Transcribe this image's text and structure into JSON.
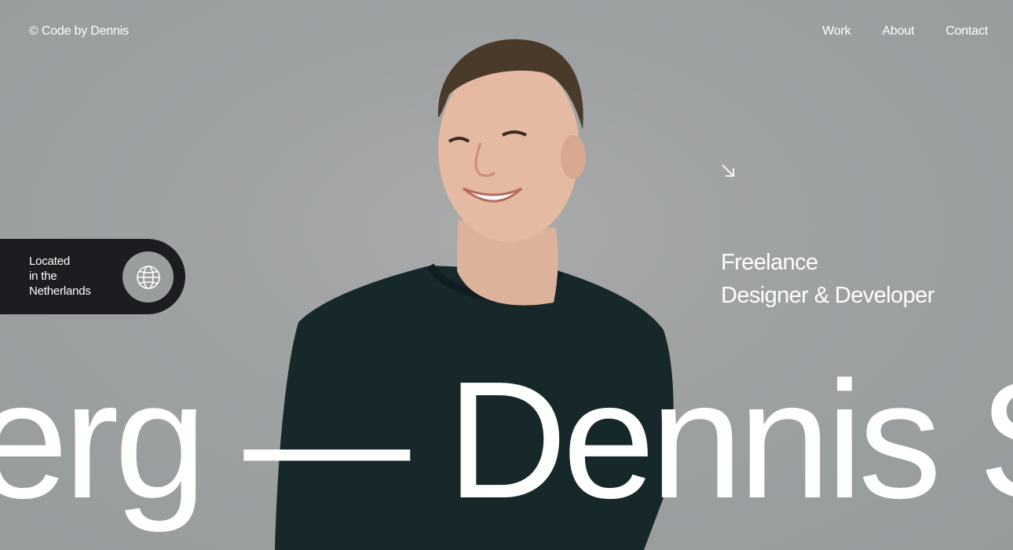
{
  "header": {
    "logo": "© Code by Dennis",
    "nav": [
      "Work",
      "About",
      "Contact"
    ]
  },
  "location": {
    "lines": [
      "Located",
      "in the",
      "Netherlands"
    ],
    "icon": "globe-icon"
  },
  "hero": {
    "arrow_icon": "arrow-down-right-icon",
    "role_lines": [
      "Freelance",
      "Designer & Developer"
    ],
    "marquee_text": "erg — Dennis Sn"
  },
  "colors": {
    "background": "#999d9e",
    "pill": "#1c1d20",
    "text": "#ffffff",
    "sweater": "#17282b",
    "hair": "#4a3a2a",
    "skin": "#e2b49c"
  }
}
